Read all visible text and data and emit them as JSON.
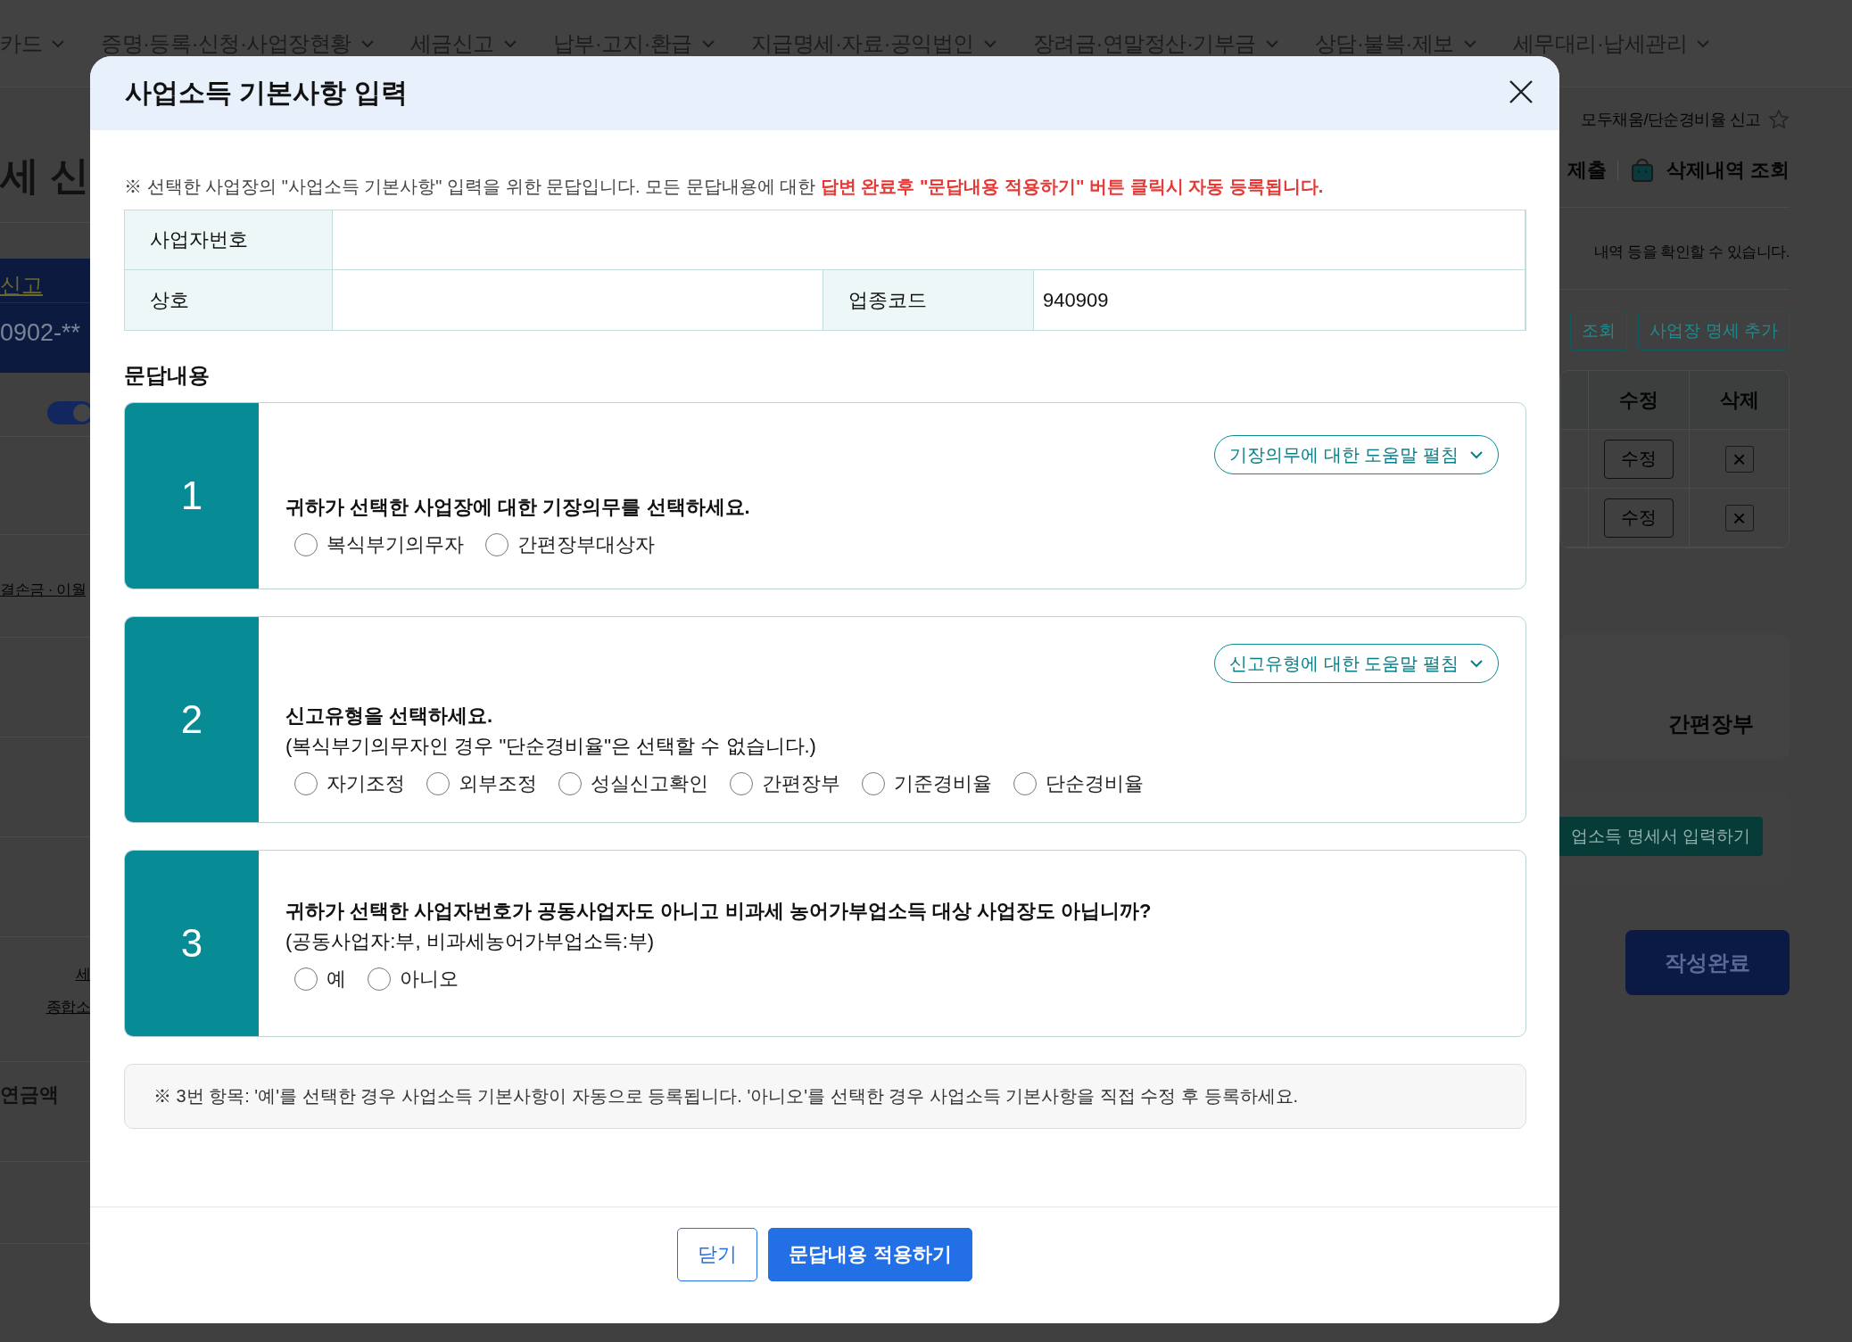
{
  "nav": [
    {
      "label": "카드"
    },
    {
      "label": "증명·등록·신청·사업장현황"
    },
    {
      "label": "세금신고"
    },
    {
      "label": "납부·고지·환급"
    },
    {
      "label": "지급명세·자료·공익법인"
    },
    {
      "label": "장려금·연말정산·기부금"
    },
    {
      "label": "상담·불복·제보"
    },
    {
      "label": "세무대리·납세관리"
    }
  ],
  "page_behind": {
    "left": {
      "title": "세 신",
      "tab": "신고",
      "number": "0902-**",
      "toggle_on": true,
      "link": "결손금 · 이월",
      "links": [
        "세",
        "종합소"
      ],
      "label": "연금액"
    },
    "right": {
      "breadcrumb": "모두채움/단순경비율 신고",
      "actions": [
        "제출",
        "삭제내역 조회"
      ],
      "info": "내역 등을 확인할 수 있습니다.",
      "buttons": [
        "조회",
        "사업장 명세 추가"
      ],
      "table": {
        "columns": [
          "수정",
          "삭제"
        ],
        "rows": [
          {
            "edit": "수정",
            "delete": "×"
          },
          {
            "edit": "수정",
            "delete": "×"
          }
        ]
      },
      "bookkeeping": "간편장부",
      "detail_button": "업소득 명세서 입력하기",
      "complete_button": "작성완료"
    }
  },
  "dialog": {
    "title": "사업소득 기본사항 입력",
    "notice": {
      "text": "※ 선택한 사업장의 \"사업소득 기본사항\" 입력을 위한 문답입니다. 모든 문답내용에 대한 ",
      "emphasis": "답변 완료후 \"문답내용 적용하기\" 버튼 클릭시 자동 등록됩니다."
    },
    "info_rows": [
      [
        {
          "label": "사업자번호"
        }
      ],
      [
        {
          "label": "상호"
        },
        {
          "label": "업종코드",
          "value": "940909"
        }
      ]
    ],
    "section_title": "문답내용",
    "questions": [
      {
        "number": "1",
        "help": "기장의무에 대한 도움말 펼침",
        "text": "귀하가 선택한 사업장에 대한 기장의무를 선택하세요.",
        "options": [
          {
            "label": "복식부기의무자",
            "selected": false
          },
          {
            "label": "간편장부대상자",
            "selected": false
          }
        ]
      },
      {
        "number": "2",
        "help": "신고유형에 대한 도움말 펼침",
        "text": "신고유형을 선택하세요.",
        "subtext": "(복식부기의무자인 경우 \"단순경비율\"은 선택할 수 없습니다.)",
        "options": [
          {
            "label": "자기조정",
            "selected": false
          },
          {
            "label": "외부조정",
            "selected": false
          },
          {
            "label": "성실신고확인",
            "selected": false
          },
          {
            "label": "간편장부",
            "selected": false
          },
          {
            "label": "기준경비율",
            "selected": false
          },
          {
            "label": "단순경비율",
            "selected": false
          }
        ]
      },
      {
        "number": "3",
        "text": "귀하가 선택한 사업자번호가 공동사업자도 아니고 비과세 농어가부업소득 대상 사업장도 아닙니까?",
        "subtext": "(공동사업자:부, 비과세농어가부업소득:부)",
        "options": [
          {
            "label": "예",
            "selected": false
          },
          {
            "label": "아니오",
            "selected": false
          }
        ]
      }
    ],
    "note": "※ 3번 항목: '예'를 선택한 경우 사업소득 기본사항이 자동으로 등록됩니다. '아니오'를 선택한 경우 사업소득 기본사항을 직접 수정 후 등록하세요.",
    "buttons": [
      {
        "label": "닫기",
        "kind": "secondary"
      },
      {
        "label": "문답내용 적용하기",
        "kind": "primary"
      }
    ]
  }
}
